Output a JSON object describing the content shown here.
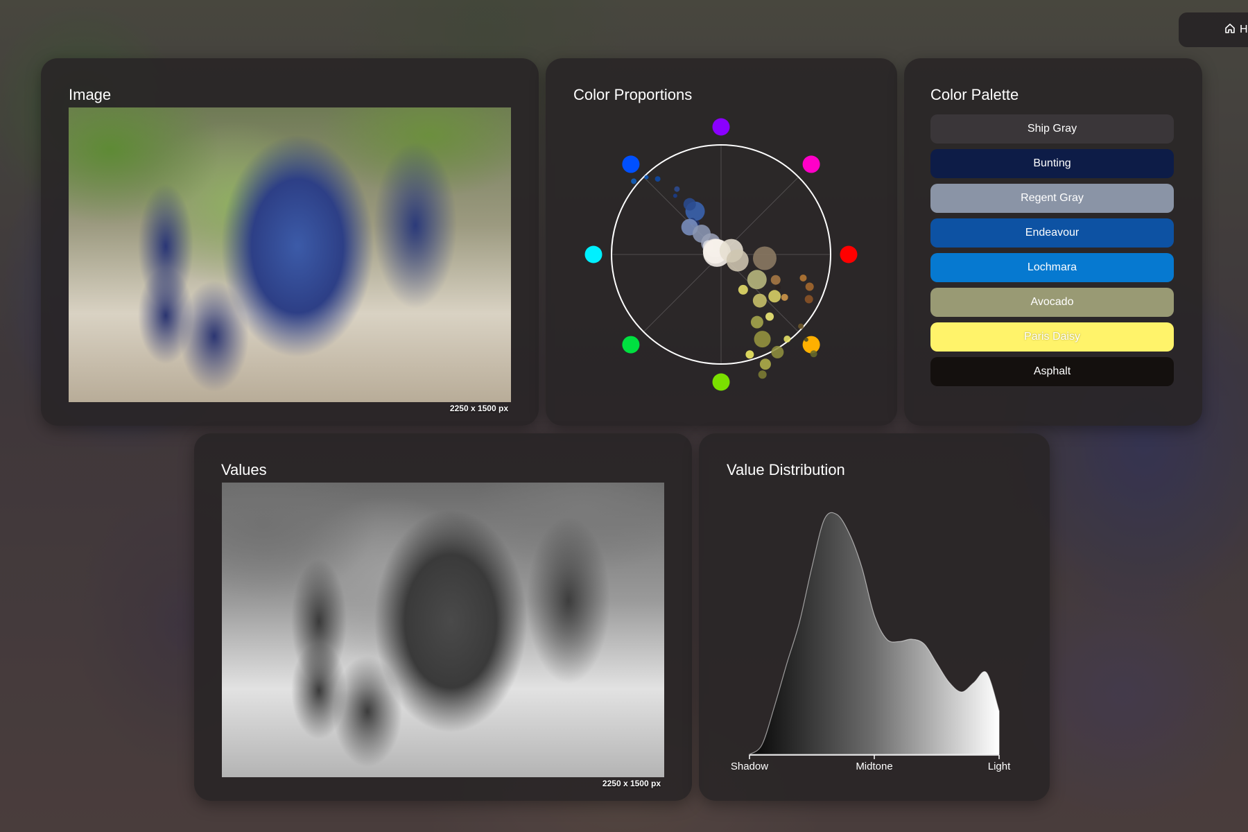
{
  "nav": {
    "home_label": "H"
  },
  "image_card": {
    "title": "Image",
    "dimensions": "2250 x 1500 px"
  },
  "wheel_card": {
    "title": "Color Proportions",
    "hue_markers": [
      {
        "name": "violet",
        "color": "#8a00ff"
      },
      {
        "name": "magenta",
        "color": "#ff00c8"
      },
      {
        "name": "red",
        "color": "#ff0000"
      },
      {
        "name": "orange",
        "color": "#ffb000"
      },
      {
        "name": "green",
        "color": "#7ae000"
      },
      {
        "name": "spring-green",
        "color": "#00e040"
      },
      {
        "name": "cyan",
        "color": "#00f0ff"
      },
      {
        "name": "blue",
        "color": "#0050ff"
      }
    ]
  },
  "palette_card": {
    "title": "Color Palette",
    "swatches": [
      {
        "name": "Ship Gray",
        "color": "#3a3639",
        "text": "#ffffff"
      },
      {
        "name": "Bunting",
        "color": "#0d1c47",
        "text": "#ffffff"
      },
      {
        "name": "Regent Gray",
        "color": "#8a94a6",
        "text": "#ffffff"
      },
      {
        "name": "Endeavour",
        "color": "#0d52a3",
        "text": "#ffffff"
      },
      {
        "name": "Lochmara",
        "color": "#0679d0",
        "text": "#ffffff"
      },
      {
        "name": "Avocado",
        "color": "#999a74",
        "text": "#ffffff"
      },
      {
        "name": "Paris Daisy",
        "color": "#fff36a",
        "text": "#ffffff"
      },
      {
        "name": "Asphalt",
        "color": "#14100e",
        "text": "#ffffff"
      }
    ]
  },
  "values_card": {
    "title": "Values",
    "dimensions": "2250 x 1500 px"
  },
  "distribution_card": {
    "title": "Value Distribution",
    "axis_labels": [
      "Shadow",
      "Midtone",
      "Light"
    ]
  },
  "chart_data": {
    "type": "area",
    "title": "Value Distribution",
    "categories": [
      "Shadow",
      "Midtone",
      "Light"
    ],
    "x": [
      0,
      5,
      10,
      15,
      20,
      25,
      30,
      35,
      40,
      45,
      50,
      55,
      60,
      65,
      70,
      75,
      80,
      85,
      90,
      95,
      100
    ],
    "series": [
      {
        "values": [
          0,
          4,
          20,
          38,
          55,
          78,
          98,
          100,
          92,
          78,
          58,
          48,
          47,
          48,
          46,
          38,
          30,
          26,
          30,
          34,
          18
        ]
      }
    ],
    "ylim": [
      0,
      100
    ],
    "grid": false
  }
}
